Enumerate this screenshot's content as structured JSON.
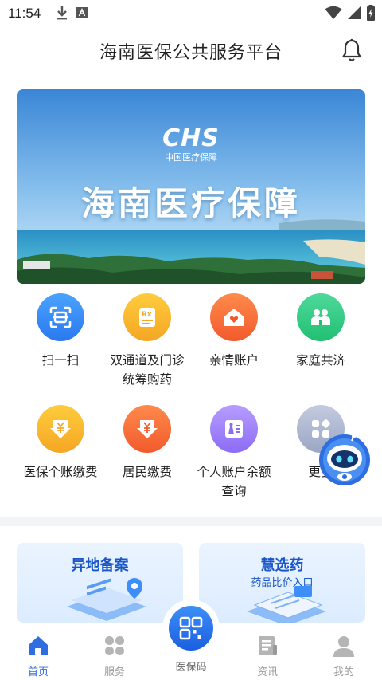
{
  "status_bar": {
    "time": "11:54"
  },
  "header": {
    "title": "海南医保公共服务平台"
  },
  "banner": {
    "logo_text": "CHS",
    "logo_subtitle": "中国医疗保障",
    "title": "海南医疗保障"
  },
  "services": [
    {
      "label": "扫一扫",
      "icon": "scan-icon",
      "color_from": "#4aa3ff",
      "color_to": "#2a78ef"
    },
    {
      "label": "双通道及门诊统筹购药",
      "icon": "prescription-icon",
      "color_from": "#ffcc3d",
      "color_to": "#f5a623"
    },
    {
      "label": "亲情账户",
      "icon": "home-heart-icon",
      "color_from": "#ff8a4c",
      "color_to": "#f25a2c"
    },
    {
      "label": "家庭共济",
      "icon": "family-icon",
      "color_from": "#4fd99a",
      "color_to": "#21bf73"
    },
    {
      "label": "医保个账缴费",
      "icon": "yen-download-icon",
      "color_from": "#ffcc3d",
      "color_to": "#f5a623"
    },
    {
      "label": "居民缴费",
      "icon": "yen-download-icon",
      "color_from": "#ff8a4c",
      "color_to": "#f25a2c"
    },
    {
      "label": "个人账户余额查询",
      "icon": "id-card-icon",
      "color_from": "#b79cff",
      "color_to": "#8c6cf5"
    },
    {
      "label": "更多",
      "icon": "apps-icon",
      "color_from": "#c3cbe0",
      "color_to": "#9aa6c4"
    }
  ],
  "cards": [
    {
      "title": "异地备案",
      "subtitle": ""
    },
    {
      "title": "慧选药",
      "subtitle": "药品比价入口"
    }
  ],
  "tabbar": {
    "items": [
      {
        "label": "首页",
        "icon": "home-icon",
        "active": true
      },
      {
        "label": "服务",
        "icon": "grid-icon",
        "active": false
      },
      {
        "label": "资讯",
        "icon": "news-icon",
        "active": false
      },
      {
        "label": "我的",
        "icon": "user-icon",
        "active": false
      }
    ],
    "center_label": "医保码",
    "center_icon": "qr-code-icon"
  },
  "colors": {
    "accent": "#2f6ee0",
    "card_text": "#1a56c8"
  }
}
